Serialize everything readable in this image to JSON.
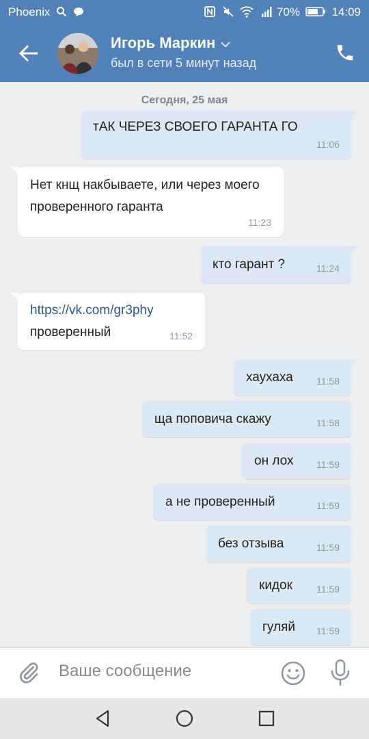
{
  "status_bar": {
    "carrier": "Phoenix",
    "battery": "70%",
    "time": "14:09"
  },
  "header": {
    "name": "Игорь Маркин",
    "status": "был в сети 5 минут назад"
  },
  "chat": {
    "date_divider": "Сегодня, 25 мая",
    "messages": [
      {
        "dir": "out",
        "text": "тАК ЧЕРЕЗ СВОЕГО ГАРАНТА ГО",
        "time": "11:06"
      },
      {
        "dir": "in",
        "text": "Нет кнщ накбываете, или через моего проверенного гаранта",
        "time": "11:23"
      },
      {
        "dir": "out",
        "text": "кто гарант ?",
        "time": "11:24"
      },
      {
        "dir": "in",
        "link": "https://vk.com/gr3phy",
        "text": "проверенный",
        "time": "11:52"
      },
      {
        "dir": "out",
        "text": "хаухаха",
        "time": "11:58"
      },
      {
        "dir": "out",
        "text": "ща поповича скажу",
        "time": "11:58"
      },
      {
        "dir": "out",
        "text": "он лох",
        "time": "11:59"
      },
      {
        "dir": "out",
        "text": "а не проверенный",
        "time": "11:59"
      },
      {
        "dir": "out",
        "text": "без отзыва",
        "time": "11:59"
      },
      {
        "dir": "out",
        "text": "кидок",
        "time": "11:59"
      },
      {
        "dir": "out",
        "text": "гуляй",
        "time": "11:59"
      }
    ]
  },
  "composer": {
    "placeholder": "Ваше сообщение"
  },
  "colors": {
    "header": "#5181b8",
    "outgoing_bubble": "#dde8f5",
    "incoming_bubble": "#ffffff",
    "link": "#2a5885",
    "background": "#edeef0"
  },
  "icons": [
    "search-icon",
    "chat-bubble-icon",
    "nfc-icon",
    "mute-icon",
    "wifi-icon",
    "signal-icon",
    "battery-icon",
    "back-arrow-icon",
    "chevron-down-icon",
    "phone-icon",
    "paperclip-icon",
    "emoji-icon",
    "microphone-icon",
    "nav-back-icon",
    "nav-home-icon",
    "nav-recent-icon"
  ]
}
